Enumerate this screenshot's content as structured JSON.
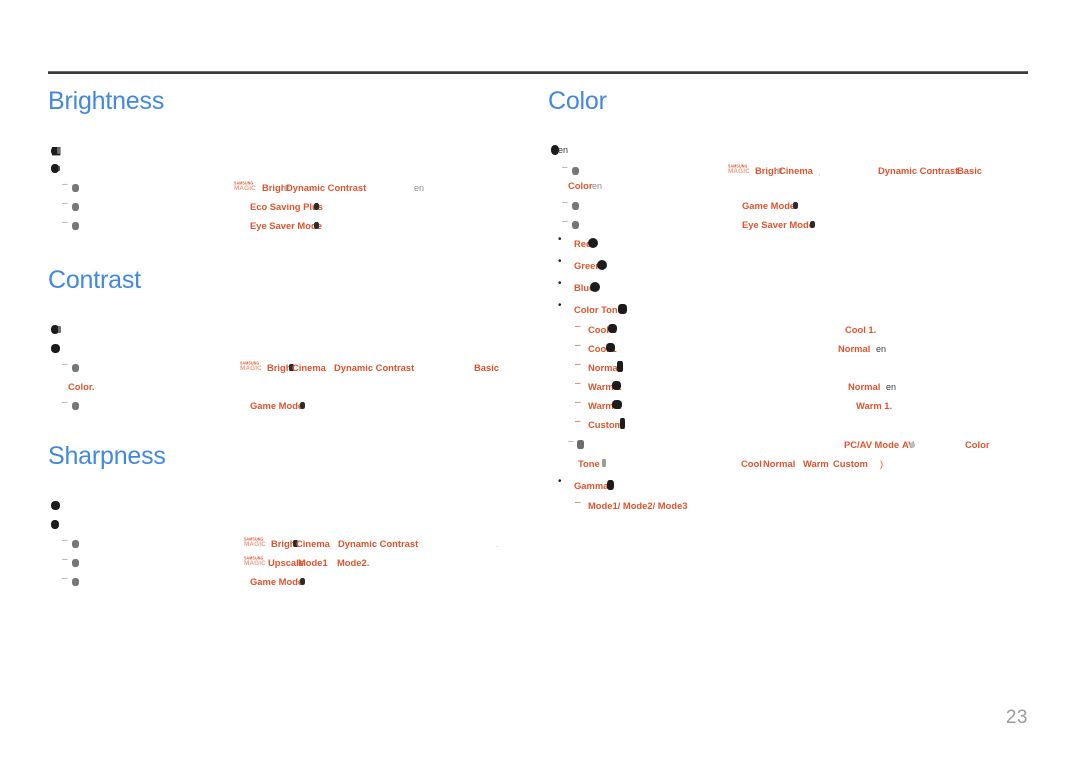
{
  "document": {
    "page_number": "23",
    "accent_heading_color": "#4288e0",
    "accent_term_color": "#e0552f",
    "body_text_color": "#231f20",
    "rule_color": "#3a3a3a"
  },
  "left_column": {
    "sections": [
      {
        "title": "Brightness",
        "lines": [
          {
            "marker": "note-glyph",
            "text": ""
          },
          {
            "marker": "note-glyph",
            "text": ""
          },
          {
            "marker": "dash",
            "terms": [
              {
                "label": "SAMSUNG",
                "type": "logo-top"
              },
              {
                "label": "MAGIC",
                "type": "logo-bottom"
              },
              {
                "label": "Bright",
                "type": "osd"
              },
              {
                "label": "Dynamic Contrast",
                "type": "osd"
              }
            ],
            "fragment": "en"
          },
          {
            "marker": "dash",
            "terms": [
              {
                "label": "Eco Saving Plus",
                "type": "osd"
              }
            ]
          },
          {
            "marker": "dash",
            "terms": [
              {
                "label": "Eye Saver Mode",
                "type": "osd"
              }
            ]
          }
        ]
      },
      {
        "title": "Contrast",
        "lines": [
          {
            "marker": "note-glyph",
            "text": ""
          },
          {
            "marker": "note-glyph",
            "text": ""
          },
          {
            "marker": "dash",
            "terms": [
              {
                "label": "SAMSUNG",
                "type": "logo-top"
              },
              {
                "label": "MAGIC",
                "type": "logo-bottom"
              },
              {
                "label": "Bright",
                "type": "osd"
              },
              {
                "label": "Cinema",
                "type": "osd"
              },
              {
                "label": "Dynamic Contrast",
                "type": "osd"
              },
              {
                "label": "Basic",
                "type": "osd"
              }
            ]
          },
          {
            "marker": "none",
            "terms": [
              {
                "label": "Color.",
                "type": "osd"
              }
            ]
          },
          {
            "marker": "dash",
            "terms": [
              {
                "label": "Game Mode",
                "type": "osd"
              }
            ]
          }
        ]
      },
      {
        "title": "Sharpness",
        "lines": [
          {
            "marker": "note-glyph",
            "text": ""
          },
          {
            "marker": "note-glyph",
            "text": ""
          },
          {
            "marker": "dash",
            "terms": [
              {
                "label": "SAMSUNG",
                "type": "logo-top"
              },
              {
                "label": "MAGIC",
                "type": "logo-bottom"
              },
              {
                "label": "Bright",
                "type": "osd"
              },
              {
                "label": "Cinema",
                "type": "osd"
              },
              {
                "label": "Dynamic Contrast",
                "type": "osd"
              }
            ]
          },
          {
            "marker": "dash",
            "terms": [
              {
                "label": "SAMSUNG",
                "type": "logo-top"
              },
              {
                "label": "MAGIC",
                "type": "logo-bottom"
              },
              {
                "label": "Upscale",
                "type": "osd"
              },
              {
                "label": "Mode1",
                "type": "osd"
              },
              {
                "label": "Mode2.",
                "type": "osd"
              }
            ]
          },
          {
            "marker": "dash",
            "terms": [
              {
                "label": "Game Mode",
                "type": "osd"
              }
            ]
          }
        ]
      }
    ]
  },
  "right_column": {
    "sections": [
      {
        "title": "Color",
        "lines": [
          {
            "marker": "note-glyph",
            "fragment": "en"
          },
          {
            "marker": "dash",
            "terms": [
              {
                "label": "SAMSUNG",
                "type": "logo-top"
              },
              {
                "label": "MAGIC",
                "type": "logo-bottom"
              },
              {
                "label": "Bright",
                "type": "osd"
              },
              {
                "label": "Cinema",
                "type": "osd"
              },
              {
                "label": "Dynamic Contrast",
                "type": "osd"
              },
              {
                "label": "Basic",
                "type": "osd"
              }
            ]
          },
          {
            "marker": "none",
            "terms": [
              {
                "label": "Color",
                "type": "osd"
              }
            ],
            "fragment": "en"
          },
          {
            "marker": "dash",
            "terms": [
              {
                "label": "Game Mode",
                "type": "osd"
              }
            ]
          },
          {
            "marker": "dash",
            "terms": [
              {
                "label": "Eye Saver Mode",
                "type": "osd"
              }
            ]
          }
        ],
        "bullets": [
          {
            "marker": "bullet",
            "label": "Red"
          },
          {
            "marker": "bullet",
            "label": "Green"
          },
          {
            "marker": "bullet",
            "label": "Blue"
          },
          {
            "marker": "bullet",
            "label": "Color Tone"
          }
        ],
        "color_tone_options": [
          {
            "marker": "endash",
            "label": "Cool 2",
            "note": "Cool 1."
          },
          {
            "marker": "endash",
            "label": "Cool 1",
            "note": "Normal",
            "note_fragment": "en"
          },
          {
            "marker": "endash",
            "label": "Normal",
            "note": ""
          },
          {
            "marker": "endash",
            "label": "Warm 1",
            "note": "Normal",
            "note_fragment": "en"
          },
          {
            "marker": "endash",
            "label": "Warm 2",
            "note": "Warm 1."
          },
          {
            "marker": "endash",
            "label": "Custom",
            "note": ""
          }
        ],
        "pcav_note": {
          "marker": "dash",
          "terms": [
            {
              "label": "PC/AV Mode",
              "type": "osd"
            },
            {
              "label": "AV",
              "type": "osd"
            },
            {
              "label": "Color",
              "type": "osd"
            },
            {
              "label": "Tone",
              "type": "osd"
            }
          ],
          "options_line": [
            {
              "label": "Cool"
            },
            {
              "label": "Normal"
            },
            {
              "label": "Warm"
            },
            {
              "label": "Custom"
            },
            {
              "label": ")"
            }
          ]
        },
        "gamma": {
          "marker": "bullet",
          "label": "Gamma",
          "modes": "Mode1/  Mode2/  Mode3"
        }
      }
    ]
  }
}
